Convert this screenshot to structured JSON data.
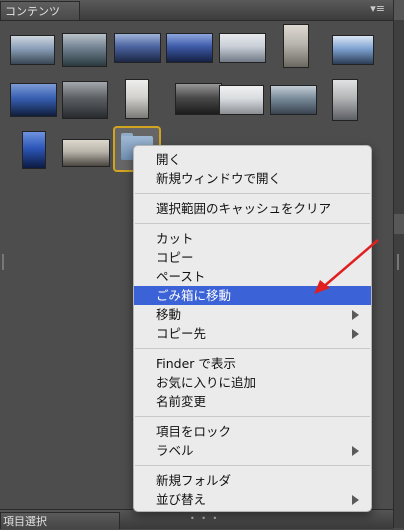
{
  "panel": {
    "tab_label": "コンテンツ",
    "menu_icon": "▾≡"
  },
  "bottom_panel": {
    "tab_label": "項目選択"
  },
  "thumbnails": [
    {
      "name": "photo-snowy-mountains",
      "colors": [
        "#8a9fb8",
        "#3a4652",
        "#cfd6de"
      ]
    },
    {
      "name": "photo-snowy-trees",
      "colors": [
        "#6f7f8f",
        "#2b3a3f",
        "#b9c2c9"
      ]
    },
    {
      "name": "photo-lake-sky",
      "colors": [
        "#4b63a0",
        "#1b2744",
        "#9fb3d8"
      ]
    },
    {
      "name": "photo-night-sky",
      "colors": [
        "#3d5aa8",
        "#142042",
        "#8ea6de"
      ]
    },
    {
      "name": "photo-cloudy-mountain",
      "colors": [
        "#c9ced6",
        "#707a86",
        "#e6e9ee"
      ]
    },
    {
      "name": "photo-snow-statue",
      "colors": [
        "#b8b6b0",
        "#6b6761",
        "#ded9d1"
      ]
    },
    {
      "name": "photo-lake-mountain",
      "colors": [
        "#7fa3d2",
        "#2c3c55",
        "#dbe6f3"
      ]
    },
    {
      "name": "photo-dusk-lake",
      "colors": [
        "#365eb0",
        "#101d3c",
        "#7e9bd6"
      ]
    },
    {
      "name": "photo-winter-forest",
      "colors": [
        "#5b5f63",
        "#272a2d",
        "#a4a9ae"
      ]
    },
    {
      "name": "photo-snowy-village",
      "colors": [
        "#d3d2cf",
        "#7b7a77",
        "#eeeeec"
      ]
    },
    {
      "name": "photo-road",
      "colors": [
        "#4a4a4a",
        "#1b1b1b",
        "#999"
      ]
    },
    {
      "name": "photo-snow-field",
      "colors": [
        "#d9dcdf",
        "#8b8f94",
        "#f0f1f2"
      ]
    },
    {
      "name": "photo-river-mountain",
      "colors": [
        "#788a99",
        "#3a4450",
        "#c4ced6"
      ]
    },
    {
      "name": "photo-snowy-riverbank",
      "colors": [
        "#b3b5b7",
        "#5c5f63",
        "#e1e2e3"
      ]
    },
    {
      "name": "photo-blue-sky",
      "colors": [
        "#2c56b8",
        "#0c1a40",
        "#6f93e0"
      ]
    },
    {
      "name": "photo-shrine-path",
      "colors": [
        "#b9b4ab",
        "#4a4640",
        "#ddd7cc"
      ]
    },
    {
      "name": "photo-frozen-river",
      "colors": [
        "#a7b2bd",
        "#3f4850",
        "#dfe4e9"
      ]
    }
  ],
  "context_menu": {
    "groups": [
      [
        {
          "label": "開く"
        },
        {
          "label": "新規ウィンドウで開く"
        }
      ],
      [
        {
          "label": "選択範囲のキャッシュをクリア"
        }
      ],
      [
        {
          "label": "カット"
        },
        {
          "label": "コピー"
        },
        {
          "label": "ペースト"
        },
        {
          "label": "ごみ箱に移動",
          "highlighted": true
        },
        {
          "label": "移動",
          "submenu": true
        },
        {
          "label": "コピー先",
          "submenu": true
        }
      ],
      [
        {
          "label": "Finder で表示"
        },
        {
          "label": "お気に入りに追加"
        },
        {
          "label": "名前変更"
        }
      ],
      [
        {
          "label": "項目をロック"
        },
        {
          "label": "ラベル",
          "submenu": true
        }
      ],
      [
        {
          "label": "新規フォルダ"
        },
        {
          "label": "並び替え",
          "submenu": true
        }
      ]
    ],
    "highlight_color": "#3b62d6"
  },
  "annotation": {
    "arrow_color": "#e02020"
  }
}
